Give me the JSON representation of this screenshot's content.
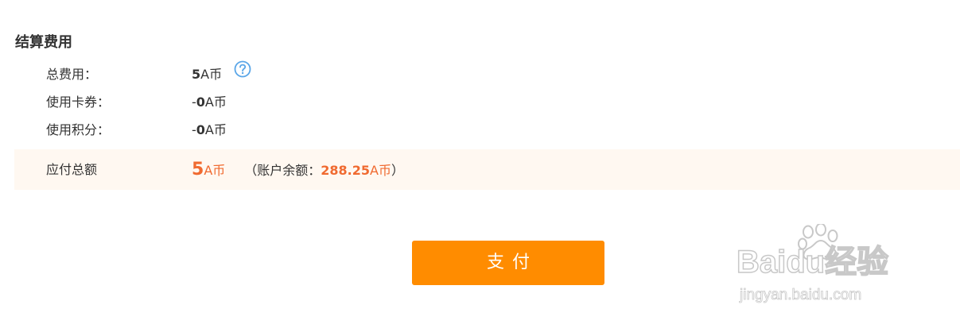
{
  "section": {
    "title": "结算费用"
  },
  "fees": {
    "total": {
      "label": "总费用：",
      "amount": "5",
      "unit": "A币"
    },
    "coupon": {
      "label": "使用卡券：",
      "sign": "-",
      "amount": "0",
      "unit": "A币"
    },
    "points": {
      "label": "使用积分：",
      "sign": "-",
      "amount": "0",
      "unit": "A币"
    }
  },
  "payable": {
    "label": "应付总额",
    "amount": "5",
    "unit": "A币",
    "balance_prefix": "（账户余额：",
    "balance_amount": "288.25",
    "balance_unit": "A币",
    "balance_suffix": "）"
  },
  "actions": {
    "pay_label": "支付"
  },
  "watermark": {
    "logo_text": "Baidu经验",
    "url": "jingyan.baidu.com"
  },
  "icons": {
    "help": "help-circle-icon",
    "paw": "baidu-paw-icon"
  },
  "colors": {
    "accent_orange": "#ff8c00",
    "amount_orange": "#f06a30",
    "highlight_bg": "#fff8f1",
    "help_icon_blue": "#5aa6e8"
  }
}
